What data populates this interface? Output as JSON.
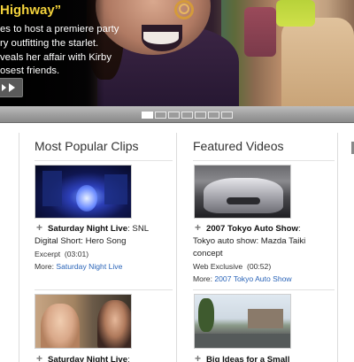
{
  "hero": {
    "title": "Highway”",
    "lines": [
      "es to host a premiere party",
      "ry outfitting the starlet.",
      "veals her affair with Kirby",
      "osest friends."
    ]
  },
  "pager": {
    "count": 7,
    "active_index": 0
  },
  "columns": {
    "popular": {
      "heading": "Most Popular Clips",
      "cards": [
        {
          "show": "Saturday Night Live",
          "title_rest": ": SNL",
          "title_line2": "Digital Short: Hero Song",
          "meta": "Excerpt  (03:01)",
          "more_label": "More: ",
          "more_link": "Saturday Night Live"
        },
        {
          "show": "Saturday Night Live",
          "title_rest": ":"
        }
      ]
    },
    "featured": {
      "heading": "Featured Videos",
      "cards": [
        {
          "show": "2007 Tokyo Auto Show",
          "title_rest": ":",
          "title_line2": "Tokyo auto show: Mazda Taiki",
          "title_line3": "concept",
          "meta": "Web Exclusive  (00:52)",
          "more_label": "More: ",
          "more_link": "2007 Tokyo Auto Show"
        },
        {
          "show": "Big Ideas for a Small",
          "title_rest": ""
        }
      ]
    }
  },
  "icons": {
    "plus": "+",
    "play": "play-icon",
    "prev": "chevron-left-icon"
  }
}
